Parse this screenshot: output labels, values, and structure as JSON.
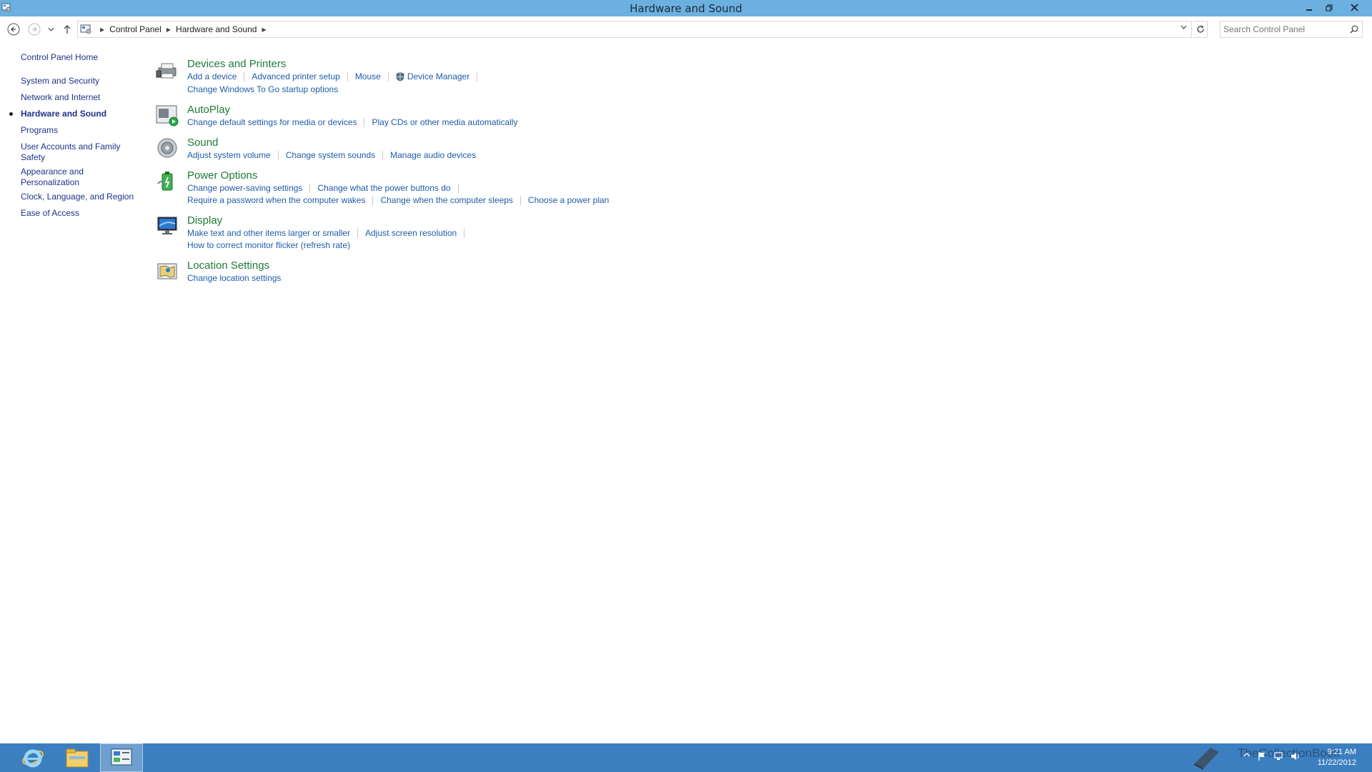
{
  "window": {
    "title": "Hardware and Sound"
  },
  "address": {
    "crumbs": [
      "Control Panel",
      "Hardware and Sound"
    ],
    "search_placeholder": "Search Control Panel"
  },
  "leftnav": {
    "home": "Control Panel Home",
    "items": [
      "System and Security",
      "Network and Internet",
      "Hardware and Sound",
      "Programs",
      "User Accounts and Family Safety",
      "Appearance and Personalization",
      "Clock, Language, and Region",
      "Ease of Access"
    ],
    "current_index": 2
  },
  "categories": {
    "devices": {
      "title": "Devices and Printers",
      "links": [
        "Add a device",
        "Advanced printer setup",
        "Mouse",
        "Device Manager",
        "Change Windows To Go startup options"
      ]
    },
    "autoplay": {
      "title": "AutoPlay",
      "links": [
        "Change default settings for media or devices",
        "Play CDs or other media automatically"
      ]
    },
    "sound": {
      "title": "Sound",
      "links": [
        "Adjust system volume",
        "Change system sounds",
        "Manage audio devices"
      ]
    },
    "power": {
      "title": "Power Options",
      "links": [
        "Change power-saving settings",
        "Change what the power buttons do",
        "Require a password when the computer wakes",
        "Change when the computer sleeps",
        "Choose a power plan"
      ]
    },
    "display": {
      "title": "Display",
      "links": [
        "Make text and other items larger or smaller",
        "Adjust screen resolution",
        "How to correct monitor flicker (refresh rate)"
      ]
    },
    "location": {
      "title": "Location Settings",
      "links": [
        "Change location settings"
      ]
    }
  },
  "taskbar": {
    "clock_time": "9:21 AM",
    "clock_date": "11/22/2012",
    "watermark": "TheCollectionBook"
  },
  "colors": {
    "titlebar": "#6cb0e0",
    "taskbar": "#3c7fc1",
    "category_title": "#1e7b36",
    "link": "#1e5ca8"
  }
}
